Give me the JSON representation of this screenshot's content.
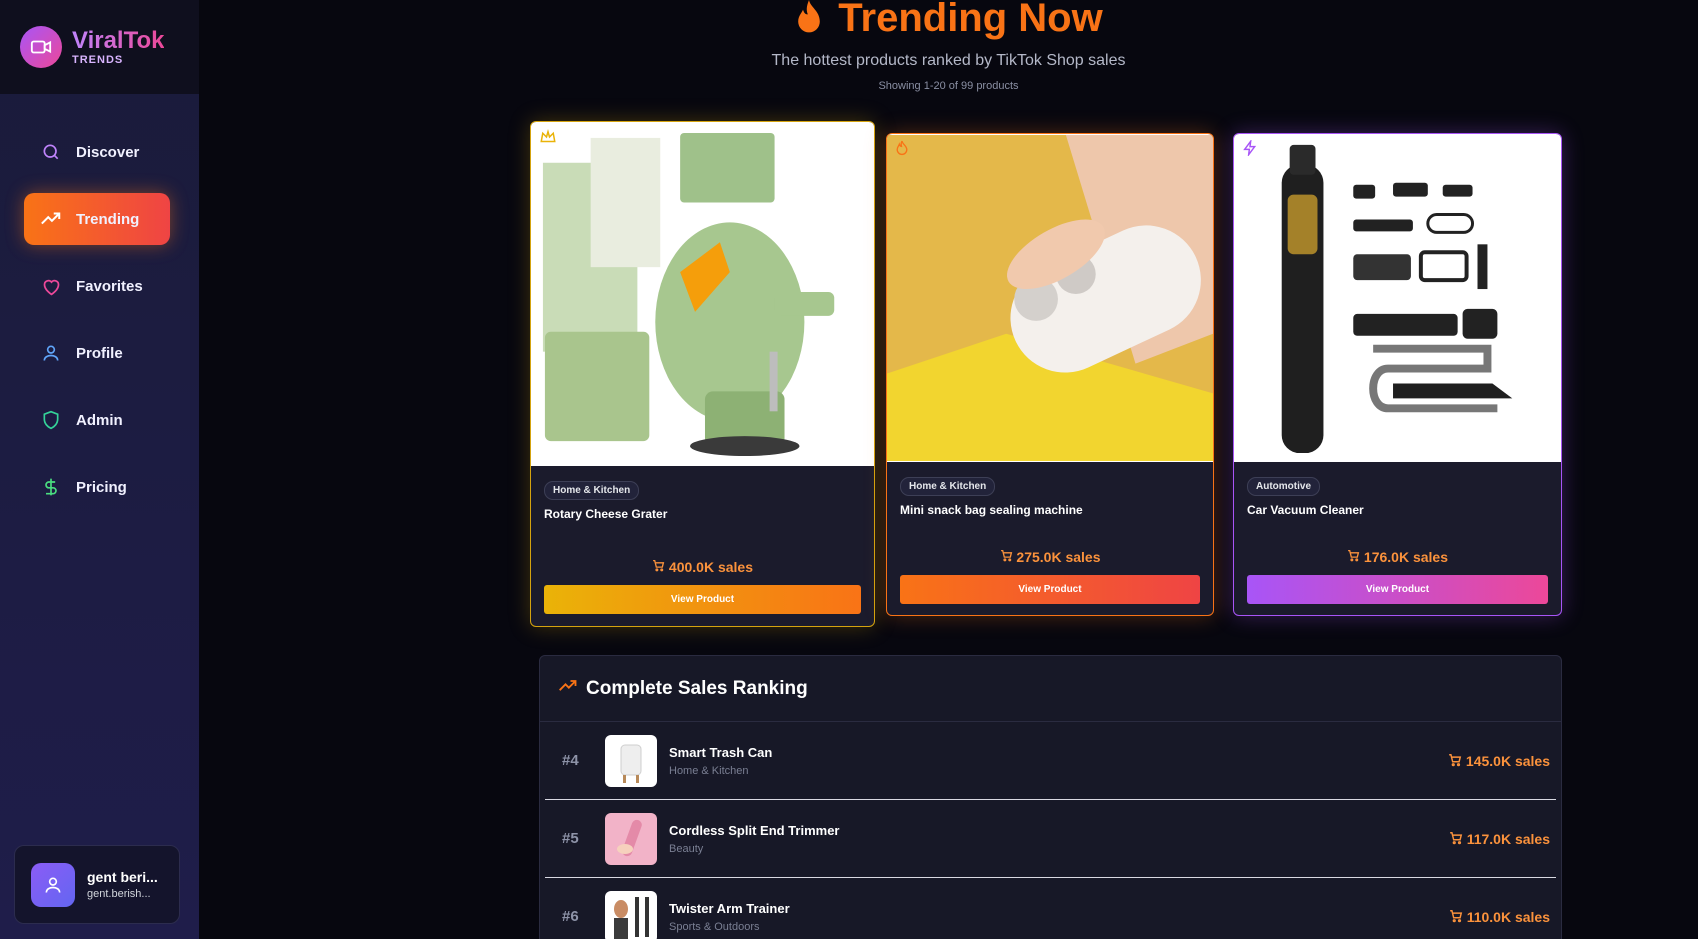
{
  "brand": {
    "name": "ViralTok",
    "sub": "TRENDS"
  },
  "nav": [
    {
      "label": "Discover"
    },
    {
      "label": "Trending"
    },
    {
      "label": "Favorites"
    },
    {
      "label": "Profile"
    },
    {
      "label": "Admin"
    },
    {
      "label": "Pricing"
    }
  ],
  "user": {
    "name": "gent beri...",
    "email": "gent.berish..."
  },
  "header": {
    "title": "Trending Now",
    "subtitle": "The hottest products ranked by TikTok Shop sales",
    "showing": "Showing 1-20 of 99 products"
  },
  "top_products": [
    {
      "category": "Home & Kitchen",
      "name": "Rotary Cheese Grater",
      "sales": "400.0K sales",
      "button": "View Product",
      "badge_icon": "crown-icon"
    },
    {
      "category": "Home & Kitchen",
      "name": "Mini snack bag sealing machine",
      "sales": "275.0K sales",
      "button": "View Product",
      "badge_icon": "flame-icon"
    },
    {
      "category": "Automotive",
      "name": "Car Vacuum Cleaner",
      "sales": "176.0K sales",
      "button": "View Product",
      "badge_icon": "bolt-icon"
    }
  ],
  "ranking": {
    "title": "Complete Sales Ranking",
    "rows": [
      {
        "rank": "#4",
        "name": "Smart Trash Can",
        "category": "Home & Kitchen",
        "sales": "145.0K sales"
      },
      {
        "rank": "#5",
        "name": "Cordless Split End Trimmer",
        "category": "Beauty",
        "sales": "117.0K sales"
      },
      {
        "rank": "#6",
        "name": "Twister Arm Trainer",
        "category": "Sports & Outdoors",
        "sales": "110.0K sales"
      }
    ]
  },
  "colors": {
    "accent": "#f97316",
    "gold": "#eab308",
    "purple": "#a855f7",
    "pink": "#ec4899",
    "sales": "#fb923c"
  }
}
